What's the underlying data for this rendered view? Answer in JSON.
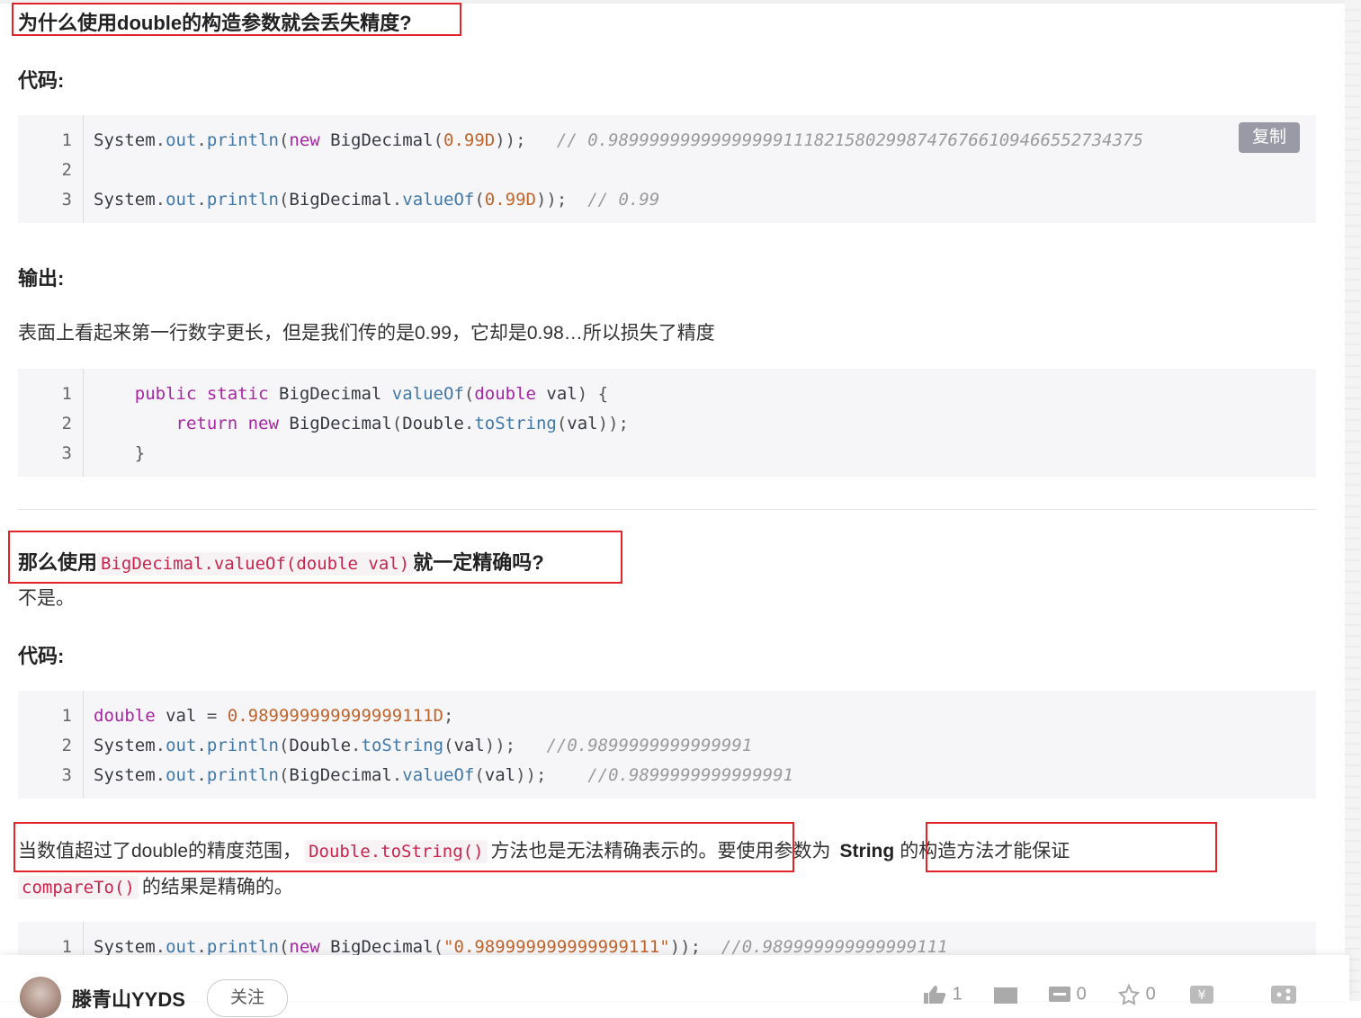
{
  "heading1": "为什么使用double的构造参数就会丢失精度?",
  "label_code1": "代码:",
  "copy_label": "复制",
  "block1": {
    "lines": [
      {
        "n": "1",
        "parts": [
          [
            "cls",
            "System"
          ],
          [
            "punc",
            "."
          ],
          [
            "fn",
            "out"
          ],
          [
            "punc",
            "."
          ],
          [
            "fn",
            "println"
          ],
          [
            "punc",
            "("
          ],
          [
            "kw",
            "new"
          ],
          [
            "cls",
            " BigDecimal"
          ],
          [
            "punc",
            "("
          ],
          [
            "num",
            "0.99D"
          ],
          [
            "punc",
            "));  "
          ],
          [
            "com",
            " // 0.98999999999999999111821580299874767661094665527343​75"
          ]
        ]
      },
      {
        "n": "2",
        "parts": []
      },
      {
        "n": "3",
        "parts": [
          [
            "cls",
            "System"
          ],
          [
            "punc",
            "."
          ],
          [
            "fn",
            "out"
          ],
          [
            "punc",
            "."
          ],
          [
            "fn",
            "println"
          ],
          [
            "punc",
            "("
          ],
          [
            "cls",
            "BigDecimal"
          ],
          [
            "punc",
            "."
          ],
          [
            "fn",
            "valueOf"
          ],
          [
            "punc",
            "("
          ],
          [
            "num",
            "0.99D"
          ],
          [
            "punc",
            "));  "
          ],
          [
            "com",
            "// 0.99"
          ]
        ]
      }
    ]
  },
  "label_output": "输出:",
  "para_output": "表面上看起来第一行数字更长，但是我们传的是0.99，它却是0.98…所以损失了精度",
  "block2": {
    "lines": [
      {
        "n": "1",
        "parts": [
          [
            "cls",
            "    "
          ],
          [
            "kw",
            "public"
          ],
          [
            "cls",
            " "
          ],
          [
            "kw",
            "static"
          ],
          [
            "cls",
            " BigDecimal "
          ],
          [
            "fn",
            "valueOf"
          ],
          [
            "punc",
            "("
          ],
          [
            "kw",
            "double"
          ],
          [
            "cls",
            " val"
          ],
          [
            "punc",
            ") {"
          ]
        ]
      },
      {
        "n": "2",
        "parts": [
          [
            "cls",
            "        "
          ],
          [
            "kw",
            "return"
          ],
          [
            "cls",
            " "
          ],
          [
            "kw",
            "new"
          ],
          [
            "cls",
            " BigDecimal"
          ],
          [
            "punc",
            "("
          ],
          [
            "cls",
            "Double"
          ],
          [
            "punc",
            "."
          ],
          [
            "fn",
            "toString"
          ],
          [
            "punc",
            "("
          ],
          [
            "cls",
            "val"
          ],
          [
            "punc",
            "));"
          ]
        ]
      },
      {
        "n": "3",
        "parts": [
          [
            "punc",
            "    }"
          ]
        ]
      }
    ]
  },
  "heading2": {
    "pre": "那么使用",
    "code": "BigDecimal.valueOf(double val)",
    "post": "就一定精确吗?"
  },
  "answer": "不是。",
  "label_code2": "代码:",
  "block3": {
    "lines": [
      {
        "n": "1",
        "parts": [
          [
            "kw",
            "double"
          ],
          [
            "cls",
            " val "
          ],
          [
            "punc",
            "="
          ],
          [
            "cls",
            " "
          ],
          [
            "num",
            "0.989999999999999111D"
          ],
          [
            "punc",
            ";"
          ]
        ]
      },
      {
        "n": "2",
        "parts": [
          [
            "cls",
            "System"
          ],
          [
            "punc",
            "."
          ],
          [
            "fn",
            "out"
          ],
          [
            "punc",
            "."
          ],
          [
            "fn",
            "println"
          ],
          [
            "punc",
            "("
          ],
          [
            "cls",
            "Double"
          ],
          [
            "punc",
            "."
          ],
          [
            "fn",
            "toString"
          ],
          [
            "punc",
            "("
          ],
          [
            "cls",
            "val"
          ],
          [
            "punc",
            "));   "
          ],
          [
            "com",
            "//0.9899999999999991"
          ]
        ]
      },
      {
        "n": "3",
        "parts": [
          [
            "cls",
            "System"
          ],
          [
            "punc",
            "."
          ],
          [
            "fn",
            "out"
          ],
          [
            "punc",
            "."
          ],
          [
            "fn",
            "println"
          ],
          [
            "punc",
            "("
          ],
          [
            "cls",
            "BigDecimal"
          ],
          [
            "punc",
            "."
          ],
          [
            "fn",
            "valueOf"
          ],
          [
            "punc",
            "("
          ],
          [
            "cls",
            "val"
          ],
          [
            "punc",
            "));    "
          ],
          [
            "com",
            "//0.9899999999999991"
          ]
        ]
      }
    ]
  },
  "para_final": {
    "a": "当数值超过了double的精度范围，",
    "code1": "Double.toString()",
    "b": "方法也是无法精确表示的。要使用参数为",
    "bold": "String",
    "c": "的构造方法才能保证",
    "code2": "compareTo()",
    "d": "的结果是精确的。"
  },
  "block4": {
    "lines": [
      {
        "n": "1",
        "parts": [
          [
            "cls",
            "System"
          ],
          [
            "punc",
            "."
          ],
          [
            "fn",
            "out"
          ],
          [
            "punc",
            "."
          ],
          [
            "fn",
            "println"
          ],
          [
            "punc",
            "("
          ],
          [
            "kw",
            "new"
          ],
          [
            "cls",
            " BigDecimal"
          ],
          [
            "punc",
            "("
          ],
          [
            "str",
            "\"0.989999999999999111\""
          ],
          [
            "punc",
            "));  "
          ],
          [
            "com",
            "//0.989999999999999111"
          ]
        ]
      }
    ]
  },
  "bottom": {
    "author": "滕青山YYDS",
    "follow": "关注",
    "like_count": "1",
    "comment_count": "0",
    "star_count": "0"
  },
  "colors": {
    "highlight_box": "#e0242a",
    "code_bg": "#f6f6f8",
    "inline_code": "#c7254e",
    "keyword": "#a626a4",
    "number": "#c1642c",
    "comment": "#9a9a9a"
  }
}
